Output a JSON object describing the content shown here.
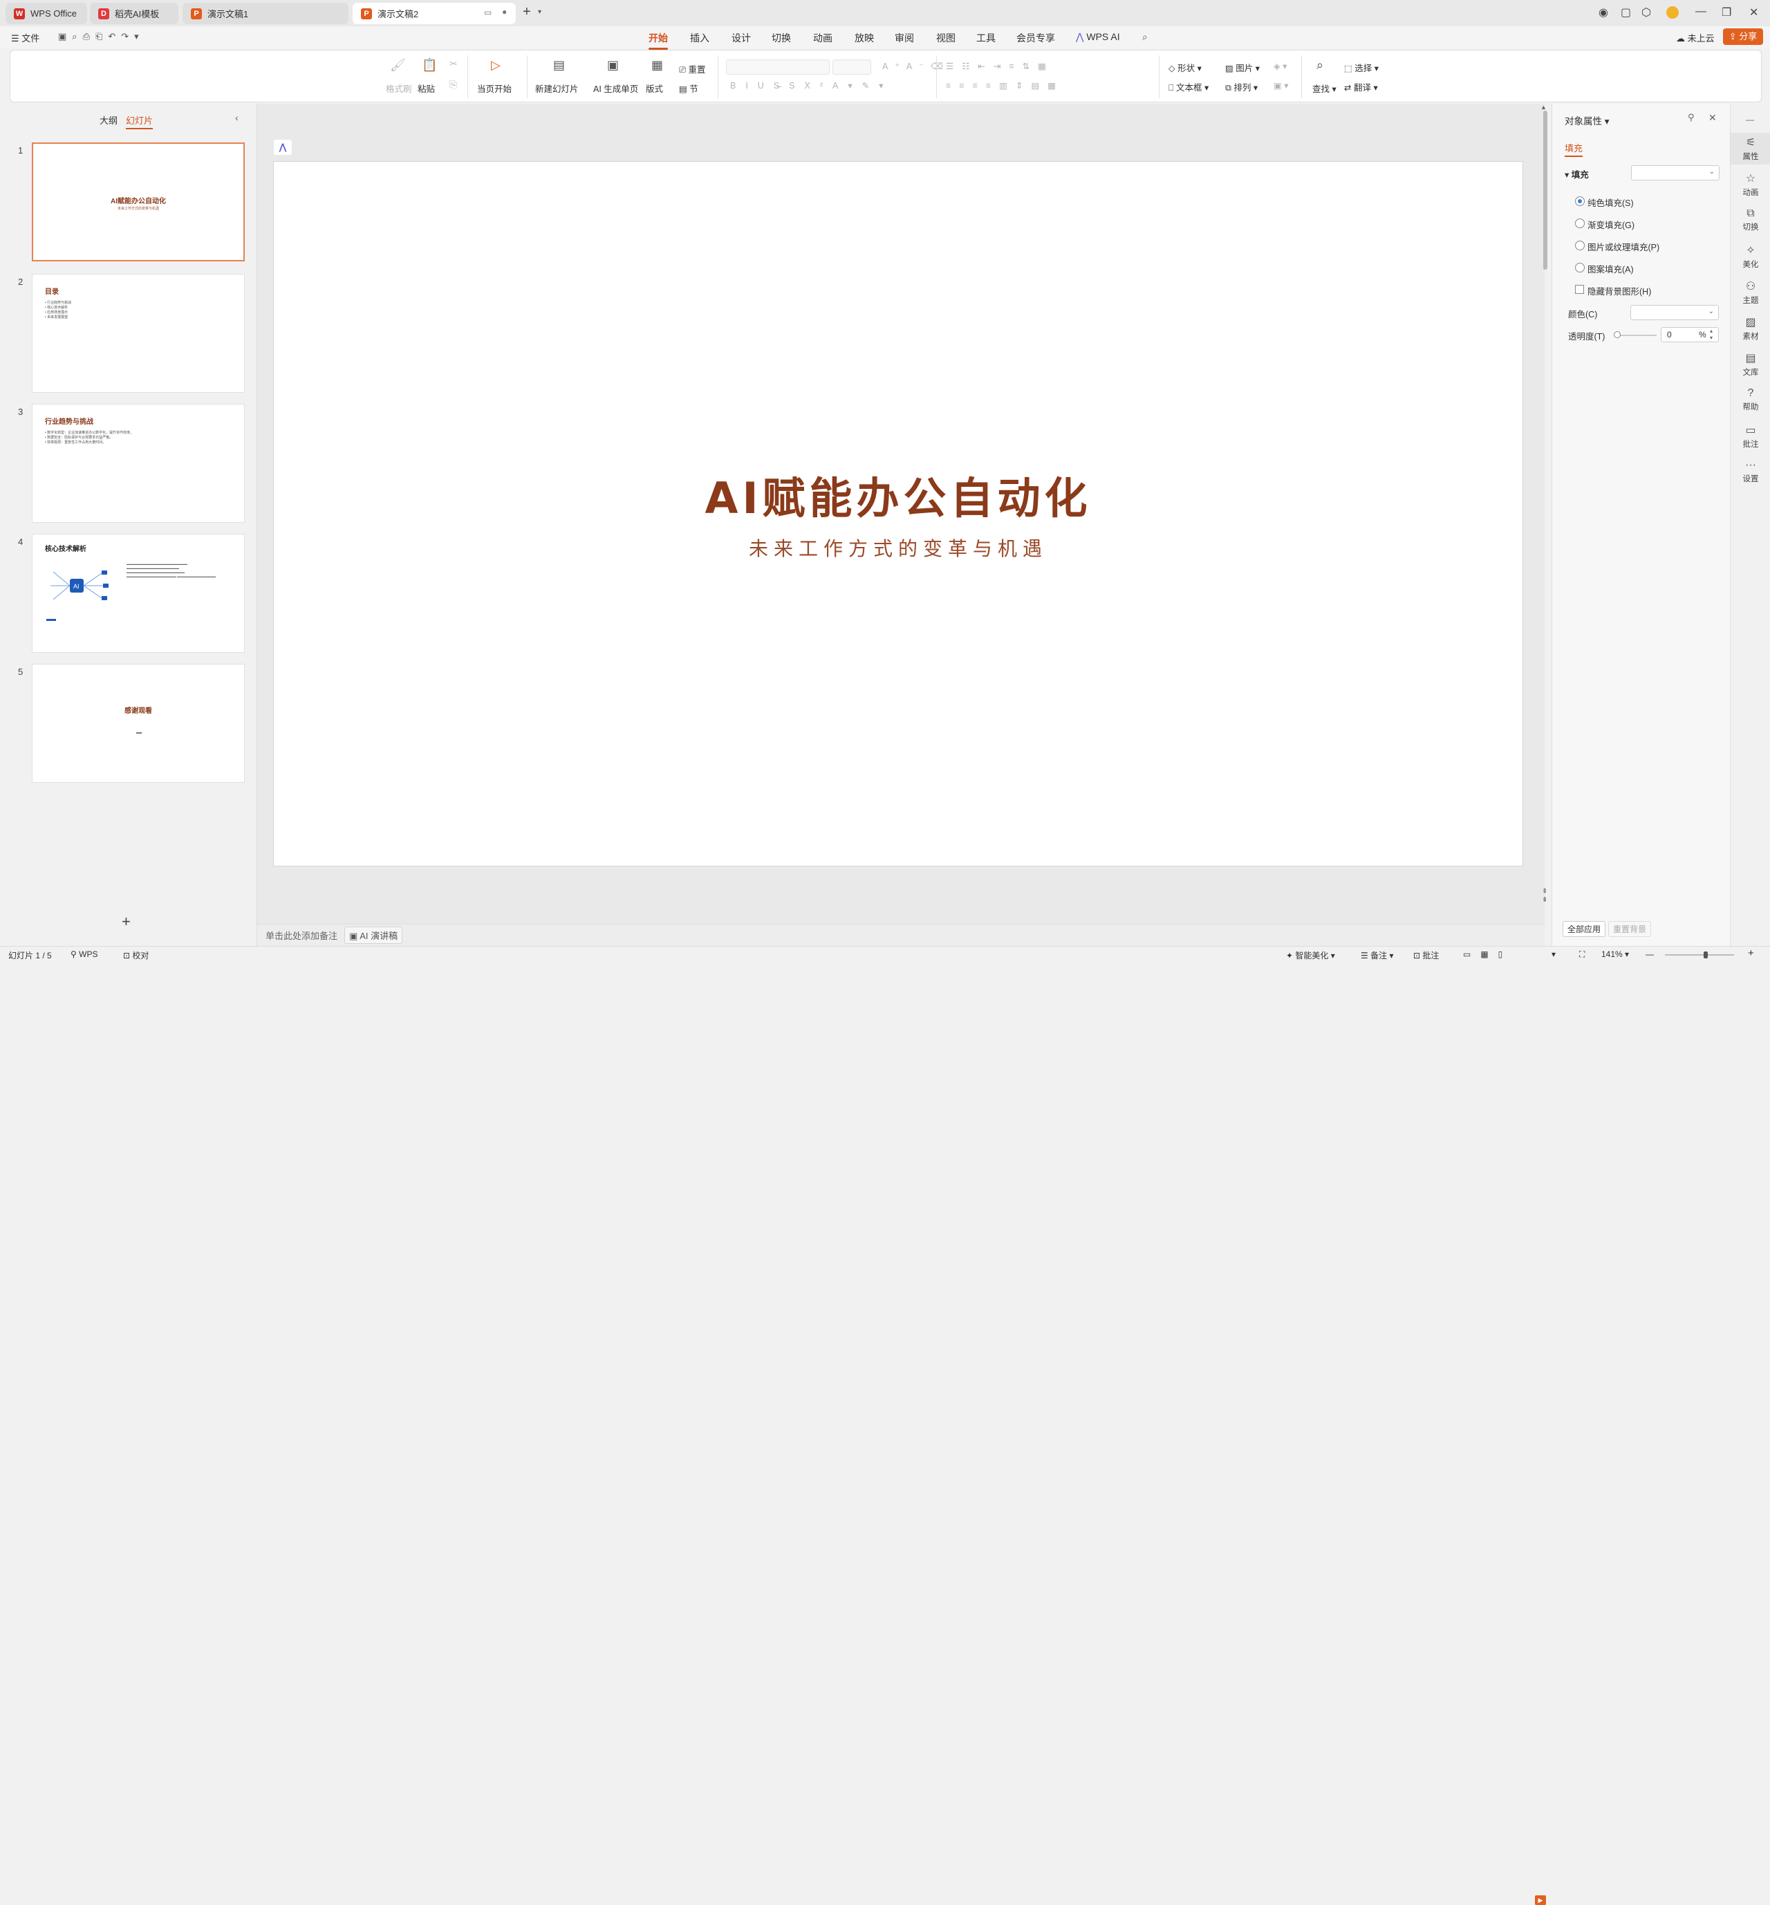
{
  "tabs": [
    {
      "label": "WPS Office"
    },
    {
      "label": "稻壳AI模板"
    },
    {
      "label": "演示文稿1"
    },
    {
      "label": "演示文稿2"
    }
  ],
  "menu": {
    "file": "文件"
  },
  "ribbon_tabs": [
    "开始",
    "插入",
    "设计",
    "切换",
    "动画",
    "放映",
    "审阅",
    "视图",
    "工具",
    "会员专享",
    "WPS AI"
  ],
  "top_right": {
    "upload": "未上云",
    "share": "分享"
  },
  "ribbon": {
    "format_painter": "格式刷",
    "paste": "粘贴",
    "from_current": "当页开始",
    "new_slide": "新建幻灯片",
    "ai_generate": "AI 生成单页",
    "layout": "版式",
    "reset": "重置",
    "section": "节",
    "shape": "形状",
    "picture": "图片",
    "select": "选择",
    "textbox": "文本框",
    "arrange": "排列",
    "find": "查找",
    "translate": "翻译"
  },
  "left_panel": {
    "outline_tab": "大纲",
    "slides_tab": "幻灯片"
  },
  "thumbnails": [
    {
      "num": "1",
      "title": "AI赋能办公自动化",
      "subtitle": "未来工作方式的变革与机遇"
    },
    {
      "num": "2",
      "title": "目录",
      "bullets": [
        "• 行业趋势与挑战",
        "• 核心技术解析",
        "• 应用场景展示",
        "• 未来发展展望"
      ]
    },
    {
      "num": "3",
      "title": "行业趋势与挑战",
      "bullets": [
        "• 数字化转型：企业加速推进办公数字化，提升协作效率。",
        "• 数据安全：隐私保护与合规要求日益严格。",
        "• 效率瓶颈：重复性工作占用大量时间。"
      ]
    },
    {
      "num": "4",
      "title": "核心技术解析"
    },
    {
      "num": "5",
      "title": "感谢观看"
    }
  ],
  "slide": {
    "title": "AI赋能办公自动化",
    "subtitle": "未来工作方式的变革与机遇"
  },
  "notes": {
    "placeholder": "单击此处添加备注",
    "ai_speech": "AI 演讲稿"
  },
  "right_panel": {
    "title": "对象属性",
    "tab": "填充",
    "section": "填充",
    "options": [
      "纯色填充(S)",
      "渐变填充(G)",
      "图片或纹理填充(P)",
      "图案填充(A)"
    ],
    "hide_bg": "隐藏背景图形(H)",
    "color_label": "颜色(C)",
    "transparency_label": "透明度(T)",
    "transparency_value": "0",
    "percent": "%",
    "apply_all": "全部应用",
    "reset_bg": "重置背景"
  },
  "right_bar": [
    "属性",
    "动画",
    "切换",
    "美化",
    "主题",
    "素材",
    "文库",
    "帮助",
    "批注",
    "设置"
  ],
  "status": {
    "slide_info": "幻灯片 1 / 5",
    "wps": "WPS",
    "proof": "校对",
    "beautify": "智能美化",
    "notes": "备注",
    "comments": "批注",
    "zoom": "141%"
  },
  "colors": {
    "accent": "#d2531f",
    "title": "#8b3a1a"
  }
}
